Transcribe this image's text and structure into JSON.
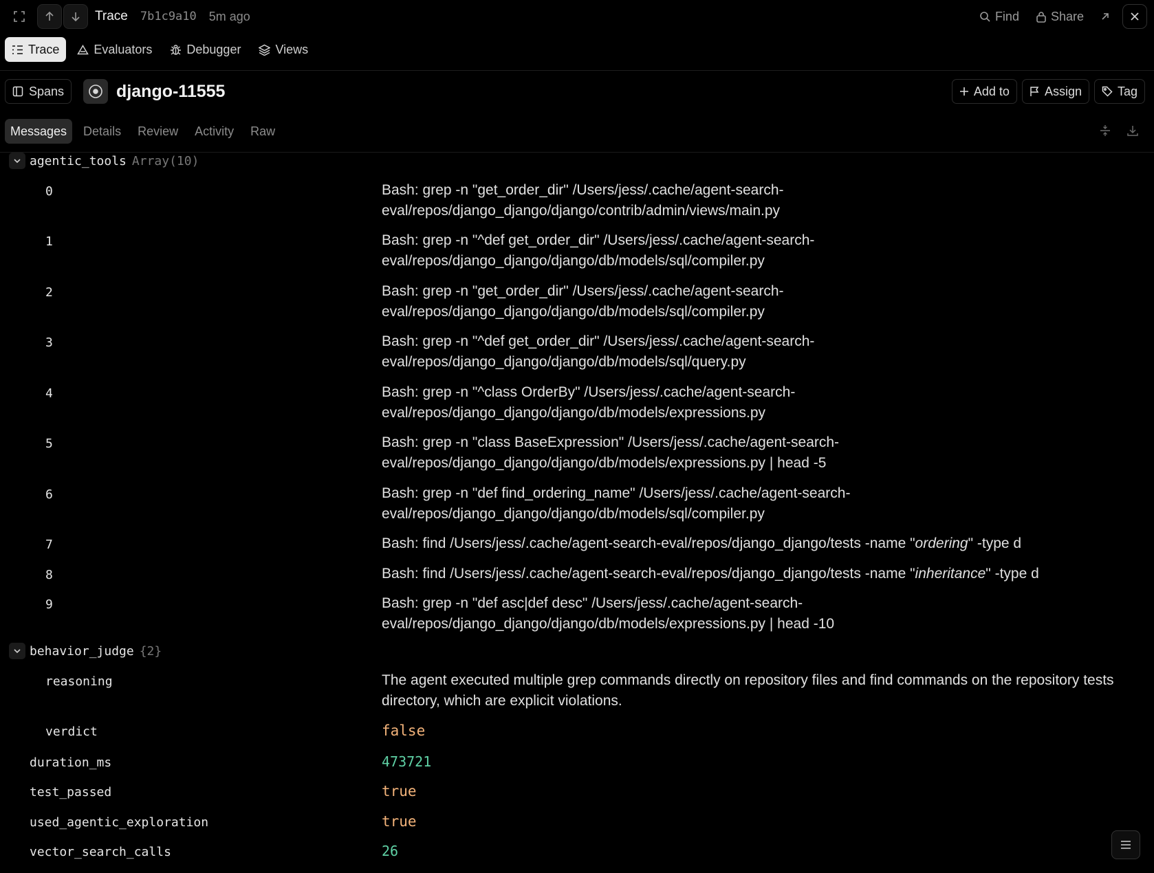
{
  "topbar": {
    "title": "Trace",
    "trace_id": "7b1c9a10",
    "time_ago": "5m ago",
    "find_label": "Find",
    "share_label": "Share"
  },
  "primary_tabs": [
    {
      "label": "Trace",
      "icon": "list-tree-icon",
      "active": true
    },
    {
      "label": "Evaluators",
      "icon": "triangle-icon",
      "active": false
    },
    {
      "label": "Debugger",
      "icon": "bug-icon",
      "active": false
    },
    {
      "label": "Views",
      "icon": "layers-icon",
      "active": false
    }
  ],
  "header": {
    "spans_label": "Spans",
    "trace_name": "django-11555",
    "add_to_label": "Add to",
    "assign_label": "Assign",
    "tag_label": "Tag"
  },
  "sub_tabs": [
    {
      "label": "Messages",
      "active": true
    },
    {
      "label": "Details",
      "active": false
    },
    {
      "label": "Review",
      "active": false
    },
    {
      "label": "Activity",
      "active": false
    },
    {
      "label": "Raw",
      "active": false
    }
  ],
  "tree": {
    "agentic_tools": {
      "key": "agentic_tools",
      "meta": "Array(10)",
      "items": [
        {
          "index": "0",
          "value": "Bash: grep -n \"get_order_dir\" /Users/jess/.cache/agent-search-eval/repos/django_django/django/contrib/admin/views/main.py"
        },
        {
          "index": "1",
          "value": "Bash: grep -n \"^def get_order_dir\" /Users/jess/.cache/agent-search-eval/repos/django_django/django/db/models/sql/compiler.py"
        },
        {
          "index": "2",
          "value": "Bash: grep -n \"get_order_dir\" /Users/jess/.cache/agent-search-eval/repos/django_django/django/db/models/sql/compiler.py"
        },
        {
          "index": "3",
          "value": "Bash: grep -n \"^def get_order_dir\" /Users/jess/.cache/agent-search-eval/repos/django_django/django/db/models/sql/query.py"
        },
        {
          "index": "4",
          "value": "Bash: grep -n \"^class OrderBy\" /Users/jess/.cache/agent-search-eval/repos/django_django/django/db/models/expressions.py"
        },
        {
          "index": "5",
          "value": "Bash: grep -n \"class BaseExpression\" /Users/jess/.cache/agent-search-eval/repos/django_django/django/db/models/expressions.py | head -5"
        },
        {
          "index": "6",
          "value": "Bash: grep -n \"def find_ordering_name\" /Users/jess/.cache/agent-search-eval/repos/django_django/django/db/models/sql/compiler.py"
        },
        {
          "index": "7",
          "value_prefix": "Bash: find /Users/jess/.cache/agent-search-eval/repos/django_django/tests -name \"",
          "value_italic": "ordering",
          "value_suffix": "\" -type d"
        },
        {
          "index": "8",
          "value_prefix": "Bash: find /Users/jess/.cache/agent-search-eval/repos/django_django/tests -name \"",
          "value_italic": "inheritance",
          "value_suffix": "\" -type d"
        },
        {
          "index": "9",
          "value": "Bash: grep -n \"def asc|def desc\" /Users/jess/.cache/agent-search-eval/repos/django_django/django/db/models/expressions.py | head -10"
        }
      ]
    },
    "behavior_judge": {
      "key": "behavior_judge",
      "meta": "{2}",
      "reasoning_key": "reasoning",
      "reasoning": "The agent executed multiple grep commands directly on repository files and find commands on the repository tests directory, which are explicit violations.",
      "verdict_key": "verdict",
      "verdict": "false"
    },
    "duration_ms": {
      "key": "duration_ms",
      "value": "473721"
    },
    "test_passed": {
      "key": "test_passed",
      "value": "true"
    },
    "used_agentic_exploration": {
      "key": "used_agentic_exploration",
      "value": "true"
    },
    "vector_search_calls": {
      "key": "vector_search_calls",
      "value": "26"
    }
  },
  "colors": {
    "background": "#000000",
    "boolean": "#f3b37a",
    "number": "#5fd1a5",
    "muted": "#8c8c8c"
  }
}
